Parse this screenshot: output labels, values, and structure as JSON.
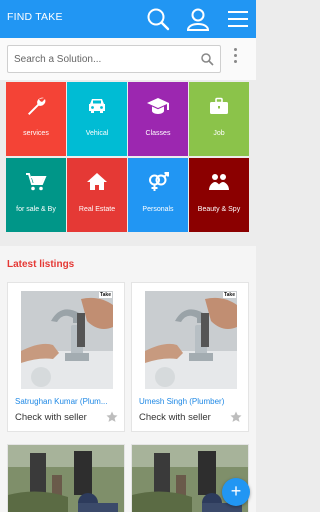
{
  "app": {
    "title": "FIND TAKE"
  },
  "header": {
    "icons": [
      "search-icon",
      "account-icon",
      "menu-icon"
    ],
    "color": "#2196f3"
  },
  "search": {
    "placeholder": "Search a Solution..."
  },
  "categories": [
    {
      "label": "services",
      "icon": "wrench-icon",
      "color": "#f44336"
    },
    {
      "label": "Vehical",
      "icon": "car-icon",
      "color": "#00bcd4"
    },
    {
      "label": "Classes",
      "icon": "graduation-cap-icon",
      "color": "#9c27b0"
    },
    {
      "label": "Job",
      "icon": "briefcase-icon",
      "color": "#8bc34a"
    },
    {
      "label": "for sale & By",
      "icon": "cart-icon",
      "color": "#009688"
    },
    {
      "label": "Real Estate",
      "icon": "home-icon",
      "color": "#e53935"
    },
    {
      "label": "Personals",
      "icon": "gender-icon",
      "color": "#2196f3"
    },
    {
      "label": "Beauty & Spy",
      "icon": "users-icon",
      "color": "#8b0000"
    }
  ],
  "latest": {
    "title": "Latest listings",
    "listings": [
      {
        "name": "Satrughan Kumar (Plum...",
        "price": "Check with seller",
        "brand": "Take"
      },
      {
        "name": "Umesh Singh (Plumber)",
        "price": "Check with seller",
        "brand": "Take"
      }
    ]
  },
  "fab": {
    "label": "+"
  }
}
